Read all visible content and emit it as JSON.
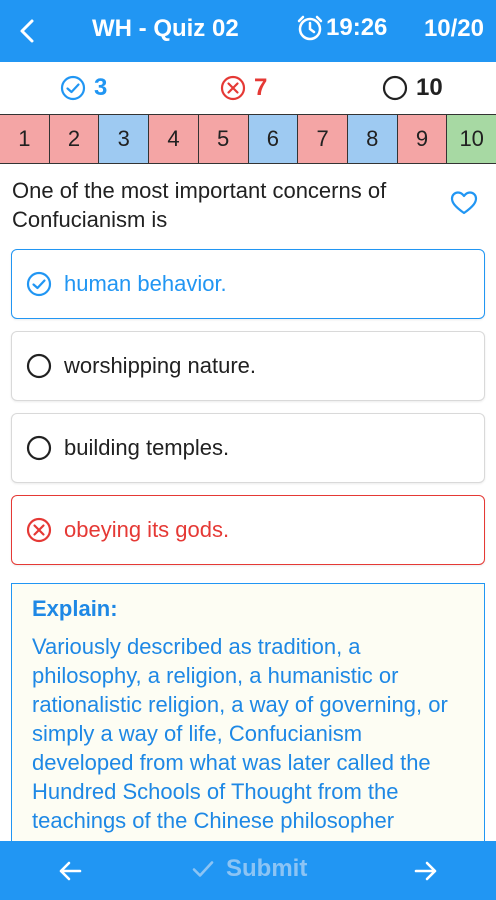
{
  "header": {
    "title": "WH - Quiz 02",
    "timer": "19:26",
    "progress": "10/20"
  },
  "stats": {
    "correct": "3",
    "wrong": "7",
    "unanswered": "10"
  },
  "question_nav": [
    {
      "label": "1",
      "status": "wrong"
    },
    {
      "label": "2",
      "status": "wrong"
    },
    {
      "label": "3",
      "status": "correct"
    },
    {
      "label": "4",
      "status": "wrong"
    },
    {
      "label": "5",
      "status": "wrong"
    },
    {
      "label": "6",
      "status": "correct"
    },
    {
      "label": "7",
      "status": "wrong"
    },
    {
      "label": "8",
      "status": "correct"
    },
    {
      "label": "9",
      "status": "wrong"
    },
    {
      "label": "10",
      "status": "skipped"
    }
  ],
  "question": {
    "text": "One of the most important concerns of Confucianism is"
  },
  "answers": [
    {
      "text": "human behavior.",
      "state": "correct"
    },
    {
      "text": "worshipping nature.",
      "state": "neutral"
    },
    {
      "text": "building temples.",
      "state": "neutral"
    },
    {
      "text": "obeying its gods.",
      "state": "wrong"
    }
  ],
  "explain": {
    "heading": "Explain:",
    "body": "Variously described as tradition, a philosophy, a religion, a humanistic or rationalistic religion, a way of governing, or simply a way of life, Confucianism developed from what was later called the Hundred Schools of Thought from the teachings of the Chinese philosopher Confucius."
  },
  "footer": {
    "submit_label": "Submit"
  },
  "colors": {
    "primary": "#2196F3",
    "correct": "#2196F3",
    "wrong": "#E53935",
    "nav_wrong": "#F4A5A5",
    "nav_correct": "#9ECAF2",
    "nav_skipped": "#A7D9A3"
  },
  "icons": {
    "back": "arrow-left-icon",
    "timer": "alarm-clock-icon",
    "favorite": "heart-outline-icon",
    "prev": "arrow-left-icon",
    "next": "arrow-right-icon",
    "submit": "check-icon"
  }
}
